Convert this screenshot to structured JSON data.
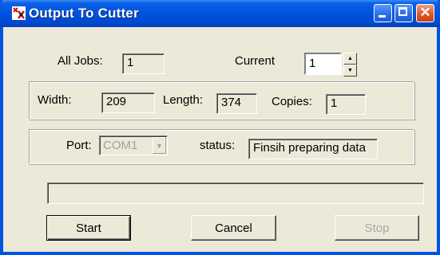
{
  "window": {
    "title": "Output To Cutter"
  },
  "jobs": {
    "all_label": "All Jobs:",
    "all_value": "1",
    "current_label": "Current",
    "current_value": "1"
  },
  "dimensions": {
    "width_label": "Width:",
    "width_value": "209",
    "length_label": "Length:",
    "length_value": "374",
    "copies_label": "Copies:",
    "copies_value": "1"
  },
  "port": {
    "label": "Port:",
    "value": "COM1",
    "status_label": "status:",
    "status_value": "Finsih preparing data"
  },
  "progress": {
    "value": 0
  },
  "buttons": {
    "start": "Start",
    "cancel": "Cancel",
    "stop": "Stop"
  },
  "colors": {
    "titlebar": "#0053df",
    "face": "#ece9d8",
    "close": "#e2572a"
  },
  "icons": {
    "app": "cutter-app-icon"
  }
}
